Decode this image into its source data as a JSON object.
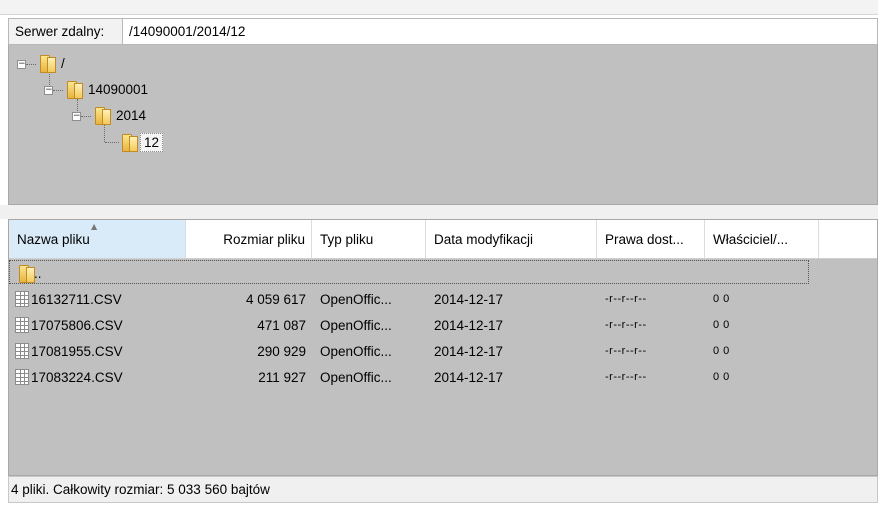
{
  "remote": {
    "label": "Serwer zdalny:",
    "path": "/14090001/2014/12"
  },
  "tree": {
    "nodes": [
      {
        "label": "/",
        "expander": "minus"
      },
      {
        "label": "14090001",
        "expander": "minus"
      },
      {
        "label": "2014",
        "expander": "minus"
      },
      {
        "label": "12",
        "selected": true
      }
    ]
  },
  "list": {
    "columns": [
      "Nazwa pliku",
      "Rozmiar pliku",
      "Typ pliku",
      "Data modyfikacji",
      "Prawa dost...",
      "Właściciel/..."
    ],
    "sorted_column": "Nazwa pliku",
    "parent_row": "..",
    "rows": [
      {
        "name": "16132711.CSV",
        "size": "4 059 617",
        "type": "OpenOffic...",
        "date": "2014-12-17",
        "perms": "-r--r--r--",
        "owner": "0 0"
      },
      {
        "name": "17075806.CSV",
        "size": "471 087",
        "type": "OpenOffic...",
        "date": "2014-12-17",
        "perms": "-r--r--r--",
        "owner": "0 0"
      },
      {
        "name": "17081955.CSV",
        "size": "290 929",
        "type": "OpenOffic...",
        "date": "2014-12-17",
        "perms": "-r--r--r--",
        "owner": "0 0"
      },
      {
        "name": "17083224.CSV",
        "size": "211 927",
        "type": "OpenOffic...",
        "date": "2014-12-17",
        "perms": "-r--r--r--",
        "owner": "0 0"
      }
    ]
  },
  "status": "4 pliki. Całkowity rozmiar: 5 033 560 bajtów",
  "icons": {
    "folder": "folder-icon",
    "file": "spreadsheet-file-icon",
    "expander": "tree-collapse-icon"
  }
}
